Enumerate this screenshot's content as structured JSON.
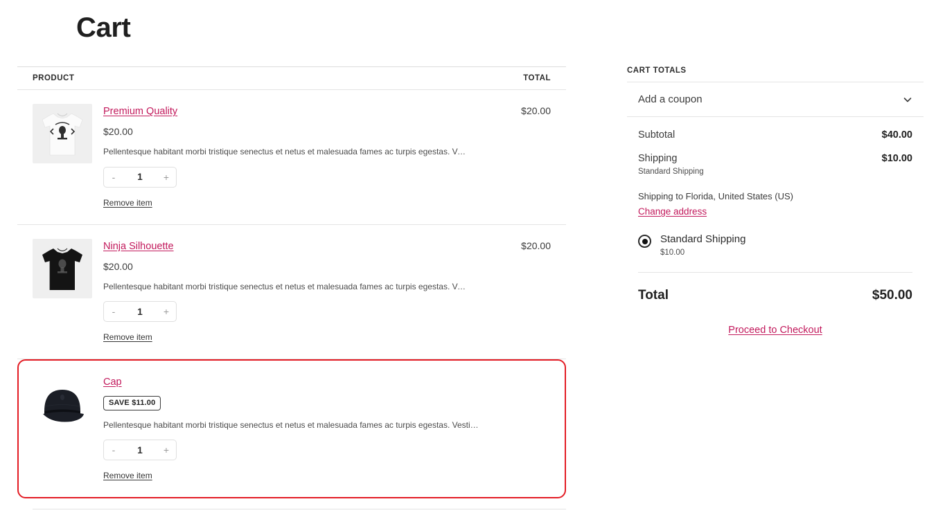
{
  "page": {
    "title": "Cart"
  },
  "table": {
    "columns": {
      "product": "PRODUCT",
      "total": "TOTAL"
    }
  },
  "items": [
    {
      "name": "Premium Quality",
      "price": "$20.00",
      "description": "Pellentesque habitant morbi tristique senectus et netus et malesuada fames ac turpis egestas. Vestibulum tortor...",
      "quantity": "1",
      "decrement_label": "-",
      "increment_label": "+",
      "remove_label": "Remove item",
      "line_total": "$20.00",
      "badge": "",
      "highlighted": false,
      "thumb": "white-tshirt-thumbnail"
    },
    {
      "name": "Ninja Silhouette",
      "price": "$20.00",
      "description": "Pellentesque habitant morbi tristique senectus et netus et malesuada fames ac turpis egestas. Vestibulum tortor...",
      "quantity": "1",
      "decrement_label": "-",
      "increment_label": "+",
      "remove_label": "Remove item",
      "line_total": "$20.00",
      "badge": "",
      "highlighted": false,
      "thumb": "black-tshirt-thumbnail"
    },
    {
      "name": "Cap",
      "price": "",
      "description": "Pellentesque habitant morbi tristique senectus et netus et malesuada fames ac turpis egestas. Vestibulum tortor...",
      "quantity": "1",
      "decrement_label": "-",
      "increment_label": "+",
      "remove_label": "Remove item",
      "line_total": "",
      "badge": "SAVE $11.00",
      "highlighted": true,
      "thumb": "black-cap-thumbnail"
    }
  ],
  "totals": {
    "heading": "CART TOTALS",
    "coupon_label": "Add a coupon",
    "coupon_icon": "chevron-down-icon",
    "subtotal_label": "Subtotal",
    "subtotal_value": "$40.00",
    "shipping_label": "Shipping",
    "shipping_value": "$10.00",
    "shipping_note": "Standard Shipping",
    "shipping_to": "Shipping to Florida, United States (US)",
    "change_address_label": "Change address",
    "shipping_option_name": "Standard Shipping",
    "shipping_option_price": "$10.00",
    "total_label": "Total",
    "total_value": "$50.00",
    "checkout_label": "Proceed to Checkout"
  },
  "colors": {
    "link": "#c2185b",
    "highlight_border": "#e31b23",
    "text": "#2b2b2b",
    "divider": "#e4e4e4"
  }
}
